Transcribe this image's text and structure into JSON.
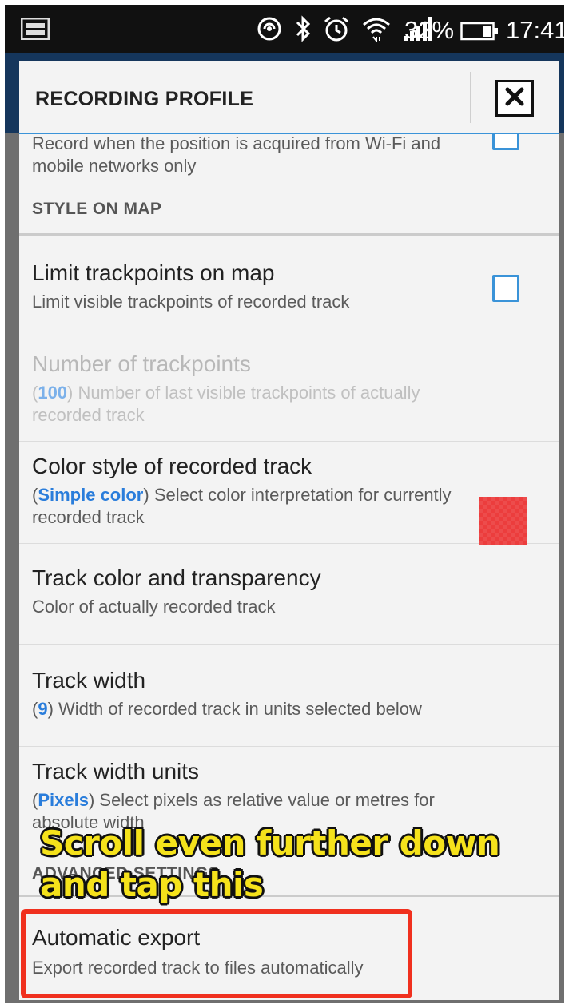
{
  "status_bar": {
    "battery_percent": "32%",
    "time": "17:41",
    "icons": [
      "screenshot-icon",
      "nfc-icon",
      "bluetooth-icon",
      "alarm-icon",
      "wifi-icon",
      "signal-icon",
      "battery-icon"
    ]
  },
  "dialog": {
    "title": "RECORDING PROFILE",
    "close_icon": "close-icon"
  },
  "rows": {
    "network_only": {
      "desc": "Record when the position is acquired from Wi-Fi and mobile networks only",
      "checked": false
    },
    "section_style": "STYLE ON MAP",
    "limit_trackpoints": {
      "title": "Limit trackpoints on map",
      "desc": "Limit visible trackpoints of recorded track",
      "checked": false
    },
    "number_trackpoints": {
      "title": "Number of trackpoints",
      "value": "100",
      "desc": "Number of last visible trackpoints of actually recorded track",
      "enabled": false
    },
    "color_style": {
      "title": "Color style of recorded track",
      "value": "Simple color",
      "desc": "Select color interpretation for currently recorded track"
    },
    "track_color": {
      "title": "Track color and transparency",
      "desc": "Color of actually recorded track",
      "color": "#ec3d3d"
    },
    "track_width": {
      "title": "Track width",
      "value": "9",
      "desc": "Width of recorded track in units selected below"
    },
    "track_width_units": {
      "title": "Track width units",
      "value": "Pixels",
      "desc": "Select pixels as relative value or metres for absolute width"
    },
    "section_advanced": "ADVANCED SETTINGS",
    "automatic_export": {
      "title": "Automatic export",
      "desc": "Export recorded track to files automatically"
    }
  },
  "annotation": {
    "line1": "Scroll even further down",
    "line2": "and tap this",
    "text_color": "#f5e21b",
    "box_color": "#f0301e"
  },
  "colors": {
    "accent": "#3a93d8",
    "value": "#2a7ddb",
    "app_bar": "#15365c"
  }
}
